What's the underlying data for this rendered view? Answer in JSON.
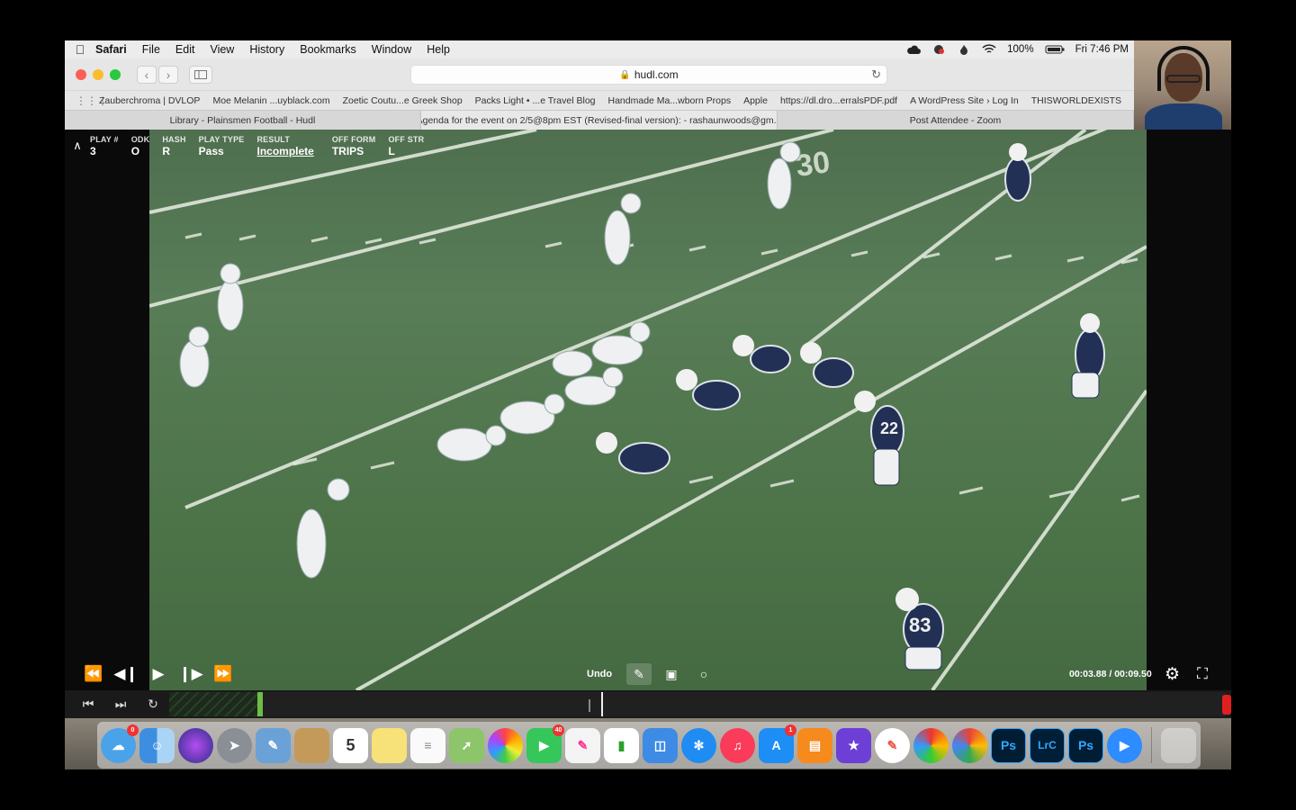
{
  "menubar": {
    "items": [
      "Safari",
      "File",
      "Edit",
      "View",
      "History",
      "Bookmarks",
      "Window",
      "Help"
    ],
    "battery": "100%",
    "clock": "Fri 7:46 PM"
  },
  "browser": {
    "url": "hudl.com",
    "bookmarks": [
      "Zauberchroma | DVLOP",
      "Moe Melanin ...uyblack.com",
      "Zoetic Coutu...e Greek Shop",
      "Packs Light • ...e Travel Blog",
      "Handmade Ma...wborn Props",
      "Apple",
      "https://dl.dro...erralsPDF.pdf",
      "A WordPress Site › Log In",
      "THISWORLDEXISTS"
    ],
    "tabs": [
      {
        "label": "Library - Plainsmen Football - Hudl",
        "active": false
      },
      {
        "label": "Agenda for the event on 2/5@8pm EST (Revised-final version): - rashaunwoods@gm...",
        "active": true
      },
      {
        "label": "Post Attendee - Zoom",
        "active": false
      }
    ]
  },
  "play_info": {
    "columns": [
      {
        "key": "PLAY #",
        "value": "3"
      },
      {
        "key": "ODK",
        "value": "O"
      },
      {
        "key": "HASH",
        "value": "R"
      },
      {
        "key": "PLAY TYPE",
        "value": "Pass"
      },
      {
        "key": "RESULT",
        "value": "Incomplete"
      },
      {
        "key": "OFF FORM",
        "value": "TRIPS"
      },
      {
        "key": "OFF STR",
        "value": "L"
      }
    ]
  },
  "player": {
    "undo_label": "Undo",
    "time": "00:03.88 / 00:09.50",
    "jersey_numbers": [
      "83",
      "22"
    ],
    "field_numbers": [
      "30"
    ]
  },
  "dock": {
    "finder_badge": "0",
    "messages_badge": "40",
    "calendar_day": "5",
    "appstore_badge": "1",
    "ps_label": "Ps",
    "lrc_label": "LrC",
    "ps2_label": "Ps"
  },
  "colors": {
    "hudl_green": "#6cbe45",
    "field_green": "#587d57",
    "home_navy": "#1f2a4a"
  }
}
